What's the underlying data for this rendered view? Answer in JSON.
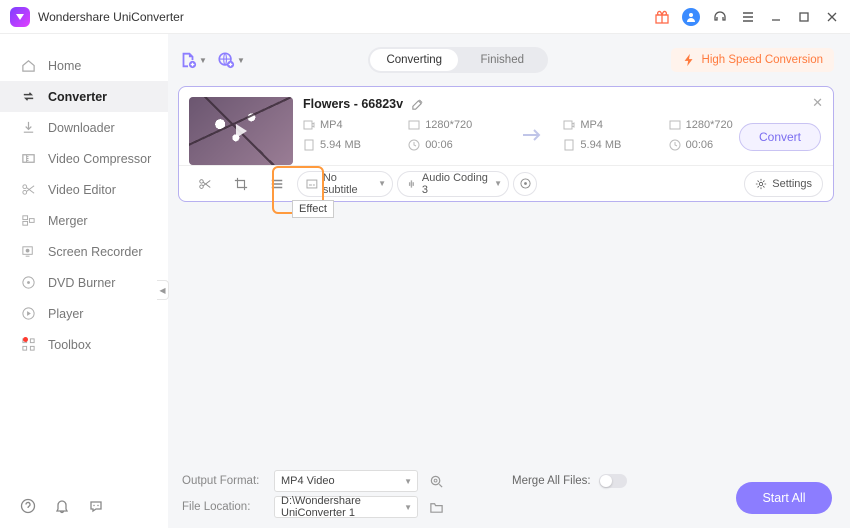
{
  "app": {
    "title": "Wondershare UniConverter"
  },
  "sidebar": {
    "items": [
      {
        "label": "Home"
      },
      {
        "label": "Converter"
      },
      {
        "label": "Downloader"
      },
      {
        "label": "Video Compressor"
      },
      {
        "label": "Video Editor"
      },
      {
        "label": "Merger"
      },
      {
        "label": "Screen Recorder"
      },
      {
        "label": "DVD Burner"
      },
      {
        "label": "Player"
      },
      {
        "label": "Toolbox"
      }
    ]
  },
  "tabs": {
    "converting": "Converting",
    "finished": "Finished"
  },
  "hsc_label": "High Speed Conversion",
  "file": {
    "title": "Flowers - 66823v",
    "src": {
      "format": "MP4",
      "res": "1280*720",
      "size": "5.94 MB",
      "dur": "00:06"
    },
    "dst": {
      "format": "MP4",
      "res": "1280*720",
      "size": "5.94 MB",
      "dur": "00:06"
    },
    "convert_label": "Convert"
  },
  "toolbar": {
    "subtitle": "No subtitle",
    "audio": "Audio Coding 3",
    "settings": "Settings",
    "effect_tooltip": "Effect"
  },
  "footer": {
    "output_label": "Output Format:",
    "output_value": "MP4 Video",
    "location_label": "File Location:",
    "location_value": "D:\\Wondershare UniConverter 1",
    "merge_label": "Merge All Files:",
    "start_all": "Start All"
  }
}
